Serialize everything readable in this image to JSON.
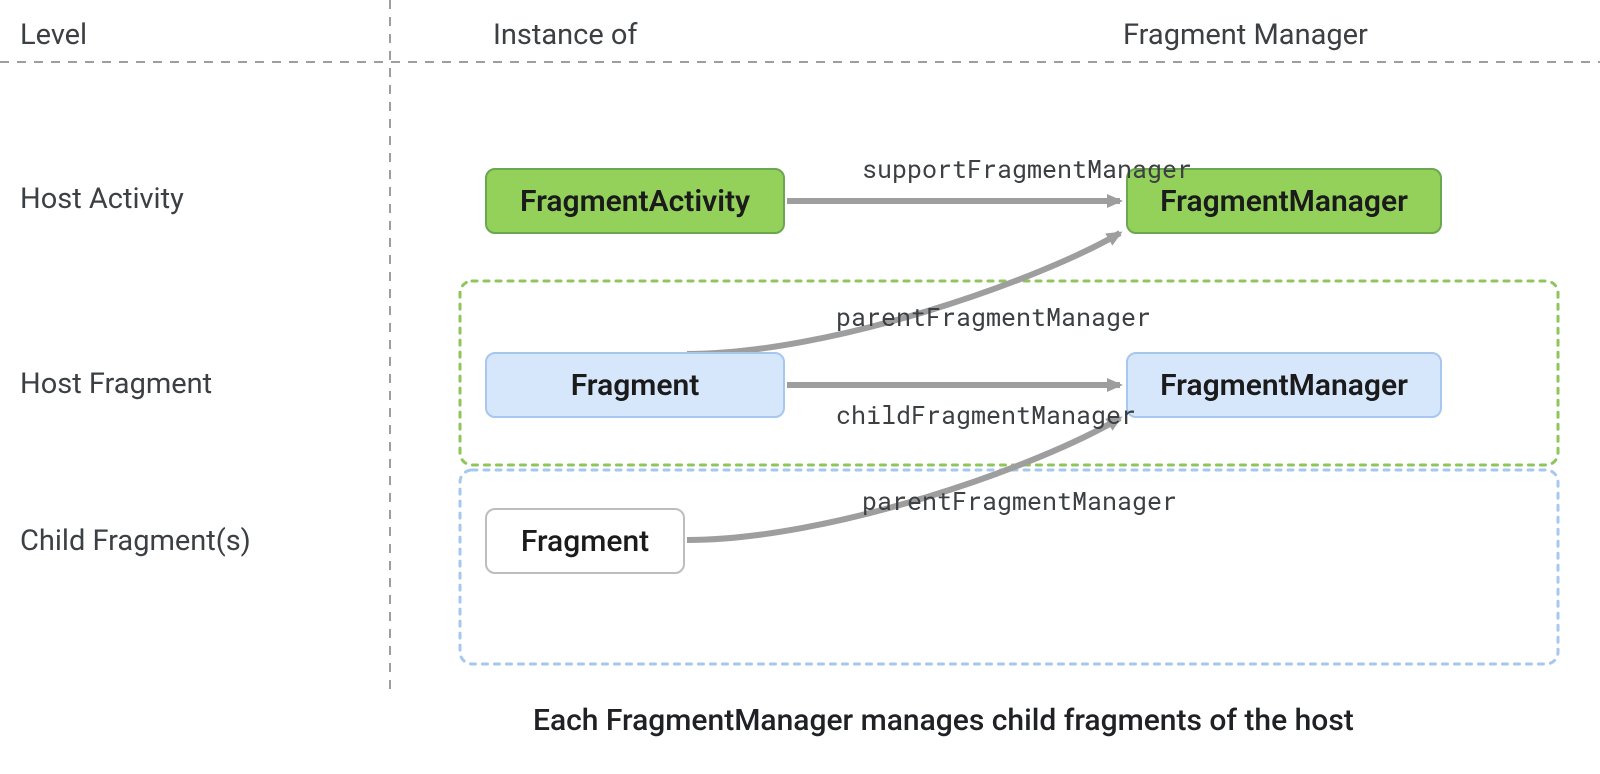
{
  "header": {
    "level": "Level",
    "instance": "Instance of",
    "manager": "Fragment Manager"
  },
  "rows": {
    "host_activity": "Host Activity",
    "host_fragment": "Host Fragment",
    "child_fragments": "Child Fragment(s)"
  },
  "nodes": {
    "fragment_activity": "FragmentActivity",
    "fragment_manager_green": "FragmentManager",
    "fragment": "Fragment",
    "fragment_manager_blue": "FragmentManager",
    "fragment_white": "Fragment"
  },
  "arrows": {
    "support_fragment_manager": "supportFragmentManager",
    "parent_fragment_manager_top": "parentFragmentManager",
    "child_fragment_manager": "childFragmentManager",
    "parent_fragment_manager_bottom": "parentFragmentManager"
  },
  "caption": "Each FragmentManager manages child fragments of the host",
  "colors": {
    "green_fill": "#93d15b",
    "green_stroke": "#6aa84f",
    "blue_fill": "#d7e7fb",
    "blue_stroke": "#a7c7ef",
    "arrow": "#9e9e9e",
    "dash": "#9e9e9e",
    "green_dot": "#8fc65c",
    "blue_dot": "#a7c7ef"
  }
}
